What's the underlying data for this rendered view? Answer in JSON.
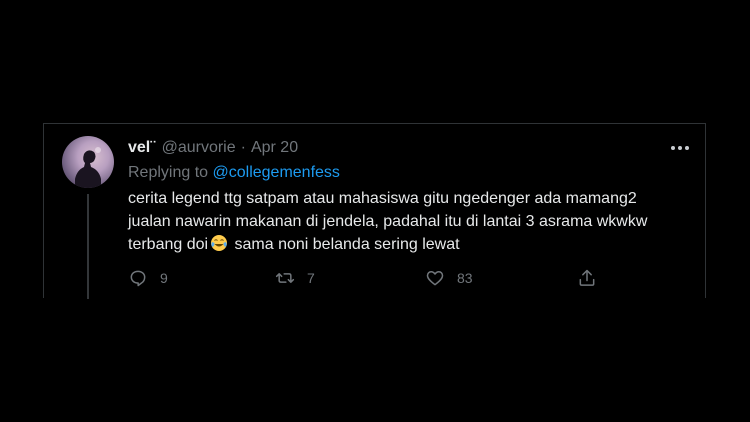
{
  "tweet": {
    "display_name": "vel¨",
    "handle": "@aurvorie",
    "separator": "·",
    "date": "Apr 20",
    "replying_prefix": "Replying to",
    "replying_handle": "@collegemenfess",
    "text_line_1": "cerita legend ttg satpam atau mahasiswa gitu ngedenger ada mamang2",
    "text_line_2": "jualan nawarin makanan di jendela, padahal itu di lantai 3 asrama wkwkw",
    "text_line_3a": "terbang doi",
    "text_line_3b": " sama noni belanda sering lewat",
    "emoji": "face-with-tears-of-joy-icon",
    "more_label": "•••"
  },
  "actions": {
    "reply_count": "9",
    "retweet_count": "7",
    "like_count": "83",
    "share_label": ""
  },
  "colors": {
    "background": "#000000",
    "text_primary": "#e7e9ea",
    "text_secondary": "#71767b",
    "accent": "#1d9bf0",
    "border": "#2f3336"
  }
}
